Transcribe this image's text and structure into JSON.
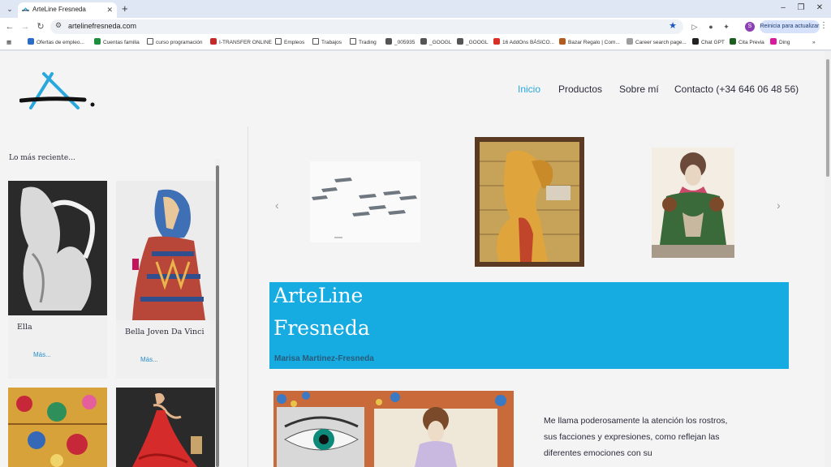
{
  "browser": {
    "tab_title": "ArteLine Fresneda",
    "url": "artelinefresneda.com",
    "update_label": "Reinicia para actualizar",
    "profile_initial": "S",
    "bookmarks": [
      {
        "label": "Ofertas de empleo...",
        "icon": "#2a6dc9"
      },
      {
        "label": "Cuentas familia",
        "icon": "#1e8e3e"
      },
      {
        "label": "curso programación",
        "icon": "folder"
      },
      {
        "label": "I-TRANSFER ONLINE",
        "icon": "#c62828"
      },
      {
        "label": "Empleos",
        "icon": "folder"
      },
      {
        "label": "Trabajos",
        "icon": "folder"
      },
      {
        "label": "Trading",
        "icon": "folder"
      },
      {
        "label": "_005935",
        "icon": "#555555"
      },
      {
        "label": "_GOOGL",
        "icon": "#555555"
      },
      {
        "label": "_GOOGL",
        "icon": "#555555"
      },
      {
        "label": "16 AddOns BÁSICO...",
        "icon": "#d93025"
      },
      {
        "label": "Bazar Regalo | Com...",
        "icon": "#b35a1f"
      },
      {
        "label": "Career search page...",
        "icon": "#9e9e9e"
      },
      {
        "label": "Chat GPT",
        "icon": "#222222"
      },
      {
        "label": "Cita Previa",
        "icon": "#1b5e20"
      },
      {
        "label": "Ding",
        "icon": "#d81b9c"
      }
    ]
  },
  "site": {
    "nav": [
      {
        "label": "Inicio",
        "active": true
      },
      {
        "label": "Productos",
        "active": false
      },
      {
        "label": "Sobre mí",
        "active": false
      },
      {
        "label": "Contacto (+34 646 06 48 56)",
        "active": false
      }
    ],
    "sidebar": {
      "title": "Lo más reciente...",
      "cards": [
        {
          "title": "Ella",
          "more": "Más..."
        },
        {
          "title": "Bella Joven Da Vinci",
          "more": "Más..."
        }
      ]
    },
    "hero": {
      "line1": "ArteLine",
      "line2": "Fresneda",
      "subtitle": "Marisa Martinez-Fresneda"
    },
    "about": {
      "text": "Me llama poderosamente la atención los rostros, sus facciones y expresiones, como reflejan las diferentes emociones con su"
    }
  },
  "colors": {
    "accent": "#16ace2",
    "link": "#29a8de",
    "text": "#2b2b3c"
  }
}
